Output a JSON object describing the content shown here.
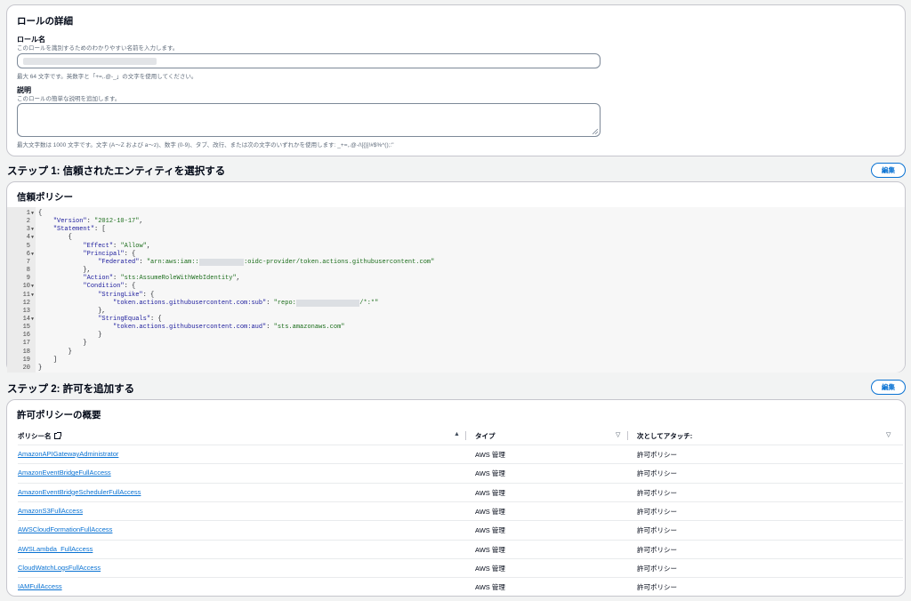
{
  "role_details": {
    "title": "ロールの詳細",
    "name_label": "ロール名",
    "name_desc": "このロールを識別するためのわかりやすい名前を入力します。",
    "name_hint": "最大 64 文字です。英数字と「+=,.@-_」の文字を使用してください。",
    "desc_label": "説明",
    "desc_desc": "このロールの簡単な説明を追加します。",
    "desc_hint": "最大文字数は 1000 文字です。文字 (A〜Z および a〜z)、数字 (0-9)、タブ、改行、または次の文字のいずれかを使用します: _+=,.@-/\\[{}]!#$%^();:\""
  },
  "step1": {
    "title": "ステップ 1: 信頼されたエンティティを選択する",
    "edit_label": "編集",
    "card_title": "信頼ポリシー",
    "code_lines": [
      {
        "n": "1",
        "fold": true
      },
      {
        "n": "2",
        "fold": false
      },
      {
        "n": "3",
        "fold": true
      },
      {
        "n": "4",
        "fold": true
      },
      {
        "n": "5",
        "fold": false
      },
      {
        "n": "6",
        "fold": true
      },
      {
        "n": "7",
        "fold": false
      },
      {
        "n": "8",
        "fold": false
      },
      {
        "n": "9",
        "fold": false
      },
      {
        "n": "10",
        "fold": true
      },
      {
        "n": "11",
        "fold": true
      },
      {
        "n": "12",
        "fold": false
      },
      {
        "n": "13",
        "fold": false
      },
      {
        "n": "14",
        "fold": true
      },
      {
        "n": "15",
        "fold": false
      },
      {
        "n": "16",
        "fold": false
      },
      {
        "n": "17",
        "fold": false
      },
      {
        "n": "18",
        "fold": false
      },
      {
        "n": "19",
        "fold": false
      },
      {
        "n": "20",
        "fold": false
      }
    ],
    "code": {
      "l1": "{",
      "l2k": "\"Version\"",
      "l2v": "\"2012-10-17\"",
      "l3k": "\"Statement\"",
      "l3r": ": [",
      "l4": "{",
      "l5k": "\"Effect\"",
      "l5v": "\"Allow\"",
      "l6k": "\"Principal\"",
      "l6r": ": {",
      "l7k": "\"Federated\"",
      "l7a": "\"arn:aws:iam::",
      "l7b": ":oidc-provider/token.actions.githubusercontent.com\"",
      "l8": "},",
      "l9k": "\"Action\"",
      "l9v": "\"sts:AssumeRoleWithWebIdentity\"",
      "l10k": "\"Condition\"",
      "l10r": ": {",
      "l11k": "\"StringLike\"",
      "l11r": ": {",
      "l12k": "\"token.actions.githubusercontent.com:sub\"",
      "l12a": "\"repo:",
      "l12b": "/*:*\"",
      "l13": "},",
      "l14k": "\"StringEquals\"",
      "l14r": ": {",
      "l15k": "\"token.actions.githubusercontent.com:aud\"",
      "l15v": "\"sts.amazonaws.com\"",
      "l16": "}",
      "l17": "}",
      "l18": "}",
      "l19": "]",
      "l20": "}"
    }
  },
  "step2": {
    "title": "ステップ 2: 許可を追加する",
    "edit_label": "編集",
    "card_title": "許可ポリシーの概要",
    "columns": {
      "policy_name": "ポリシー名",
      "type": "タイプ",
      "attached_as": "次としてアタッチ:"
    },
    "rows": [
      {
        "name": "AmazonAPIGatewayAdministrator",
        "type": "AWS 管理",
        "attached": "許可ポリシー"
      },
      {
        "name": "AmazonEventBridgeFullAccess",
        "type": "AWS 管理",
        "attached": "許可ポリシー"
      },
      {
        "name": "AmazonEventBridgeSchedulerFullAccess",
        "type": "AWS 管理",
        "attached": "許可ポリシー"
      },
      {
        "name": "AmazonS3FullAccess",
        "type": "AWS 管理",
        "attached": "許可ポリシー"
      },
      {
        "name": "AWSCloudFormationFullAccess",
        "type": "AWS 管理",
        "attached": "許可ポリシー"
      },
      {
        "name": "AWSLambda_FullAccess",
        "type": "AWS 管理",
        "attached": "許可ポリシー"
      },
      {
        "name": "CloudWatchLogsFullAccess",
        "type": "AWS 管理",
        "attached": "許可ポリシー"
      },
      {
        "name": "IAMFullAccess",
        "type": "AWS 管理",
        "attached": "許可ポリシー"
      }
    ]
  }
}
